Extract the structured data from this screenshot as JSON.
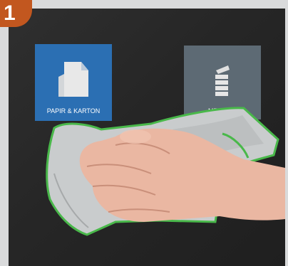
{
  "step": {
    "number": "1"
  },
  "bins": {
    "paper": {
      "label": "PAPIR & KARTON",
      "color": "#2b6fb3"
    },
    "metal": {
      "label": "METAL",
      "color": "#5d6a74"
    }
  },
  "colors": {
    "badge": "#c2571f",
    "cloth": "#c9cccd",
    "cloth_edge": "#49b84a",
    "panel": "#2a2a2a"
  },
  "icons": [
    "paper-icon",
    "can-icon"
  ]
}
